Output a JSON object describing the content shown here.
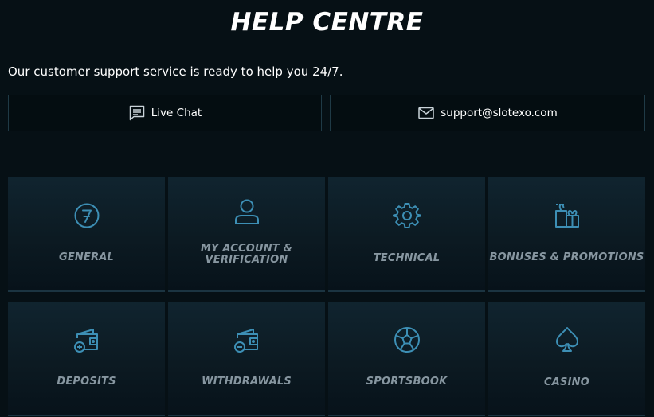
{
  "header": {
    "title": "HELP CENTRE",
    "subtitle": "Our customer support service is ready to help you 24/7."
  },
  "contact": {
    "chat_label": "Live Chat",
    "chat_icon": "chat-icon",
    "email_label": "support@slotexo.com",
    "email_icon": "mail-icon"
  },
  "categories": [
    {
      "label": "GENERAL",
      "icon": "seven-circle-icon"
    },
    {
      "label_line1": "MY ACCOUNT &",
      "label_line2": "VERIFICATION",
      "icon": "user-icon"
    },
    {
      "label": "TECHNICAL",
      "icon": "gear-icon"
    },
    {
      "label": "BONUSES & PROMOTIONS",
      "icon": "gift-icon"
    },
    {
      "label": "DEPOSITS",
      "icon": "wallet-plus-icon"
    },
    {
      "label": "WITHDRAWALS",
      "icon": "wallet-minus-icon"
    },
    {
      "label": "SPORTSBOOK",
      "icon": "soccer-ball-icon"
    },
    {
      "label": "CASINO",
      "icon": "spade-icon"
    }
  ],
  "colors": {
    "background": "#061015",
    "icon_accent": "#3d8fb5",
    "label_gray": "#8796a0",
    "border": "#1f3a46"
  }
}
